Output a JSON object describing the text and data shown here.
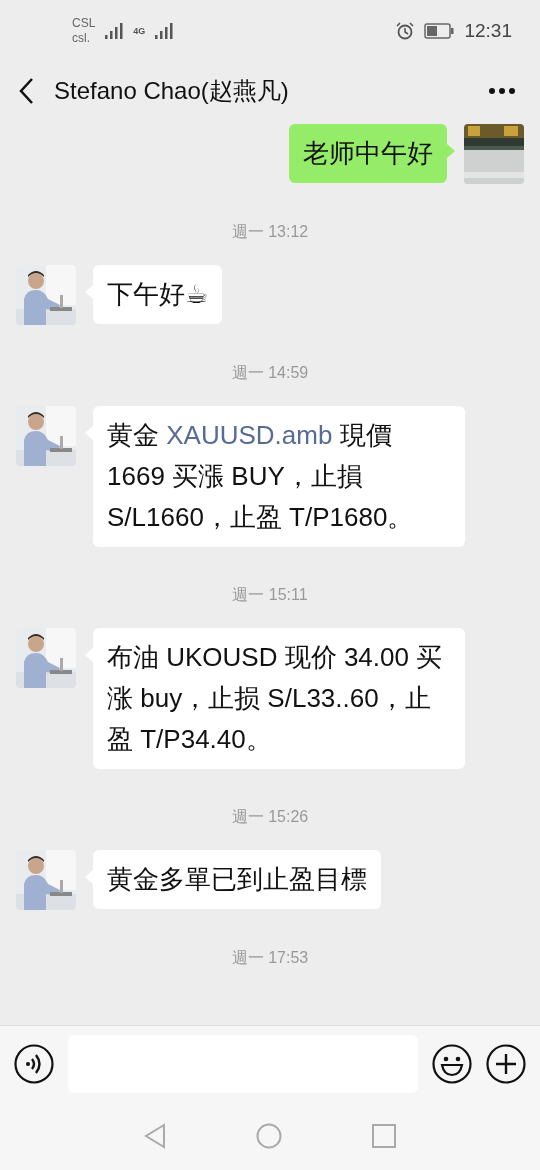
{
  "status_bar": {
    "carriers": [
      "CSL",
      "csl."
    ],
    "signal_label": "4G",
    "time": "12:31"
  },
  "header": {
    "title": "Stefano Chao(赵燕凡)"
  },
  "messages": [
    {
      "kind": "outgoing",
      "parts": [
        {
          "kind": "text",
          "text": "老师中午好"
        }
      ]
    },
    {
      "kind": "time",
      "text": "週一 13:12"
    },
    {
      "kind": "incoming",
      "parts": [
        {
          "kind": "text",
          "text": "下午好☕"
        }
      ]
    },
    {
      "kind": "time",
      "text": "週一 14:59"
    },
    {
      "kind": "incoming",
      "parts": [
        {
          "kind": "text",
          "text": "黄金 "
        },
        {
          "kind": "link",
          "text": "XAUUSD.amb"
        },
        {
          "kind": "text",
          "text": " 現價 1669 买漲 BUY，止損 S/L1660，止盈 T/P1680。"
        }
      ]
    },
    {
      "kind": "time",
      "text": "週一 15:11"
    },
    {
      "kind": "incoming",
      "parts": [
        {
          "kind": "text",
          "text": "布油 UKOUSD 现价 34.00 买涨 buy，止损 S/L33..60，止盈 T/P34.40。"
        }
      ]
    },
    {
      "kind": "time",
      "text": "週一 15:26"
    },
    {
      "kind": "incoming",
      "parts": [
        {
          "kind": "text",
          "text": "黄金多單已到止盈目標"
        }
      ]
    },
    {
      "kind": "time",
      "text": "週一 17:53"
    }
  ]
}
